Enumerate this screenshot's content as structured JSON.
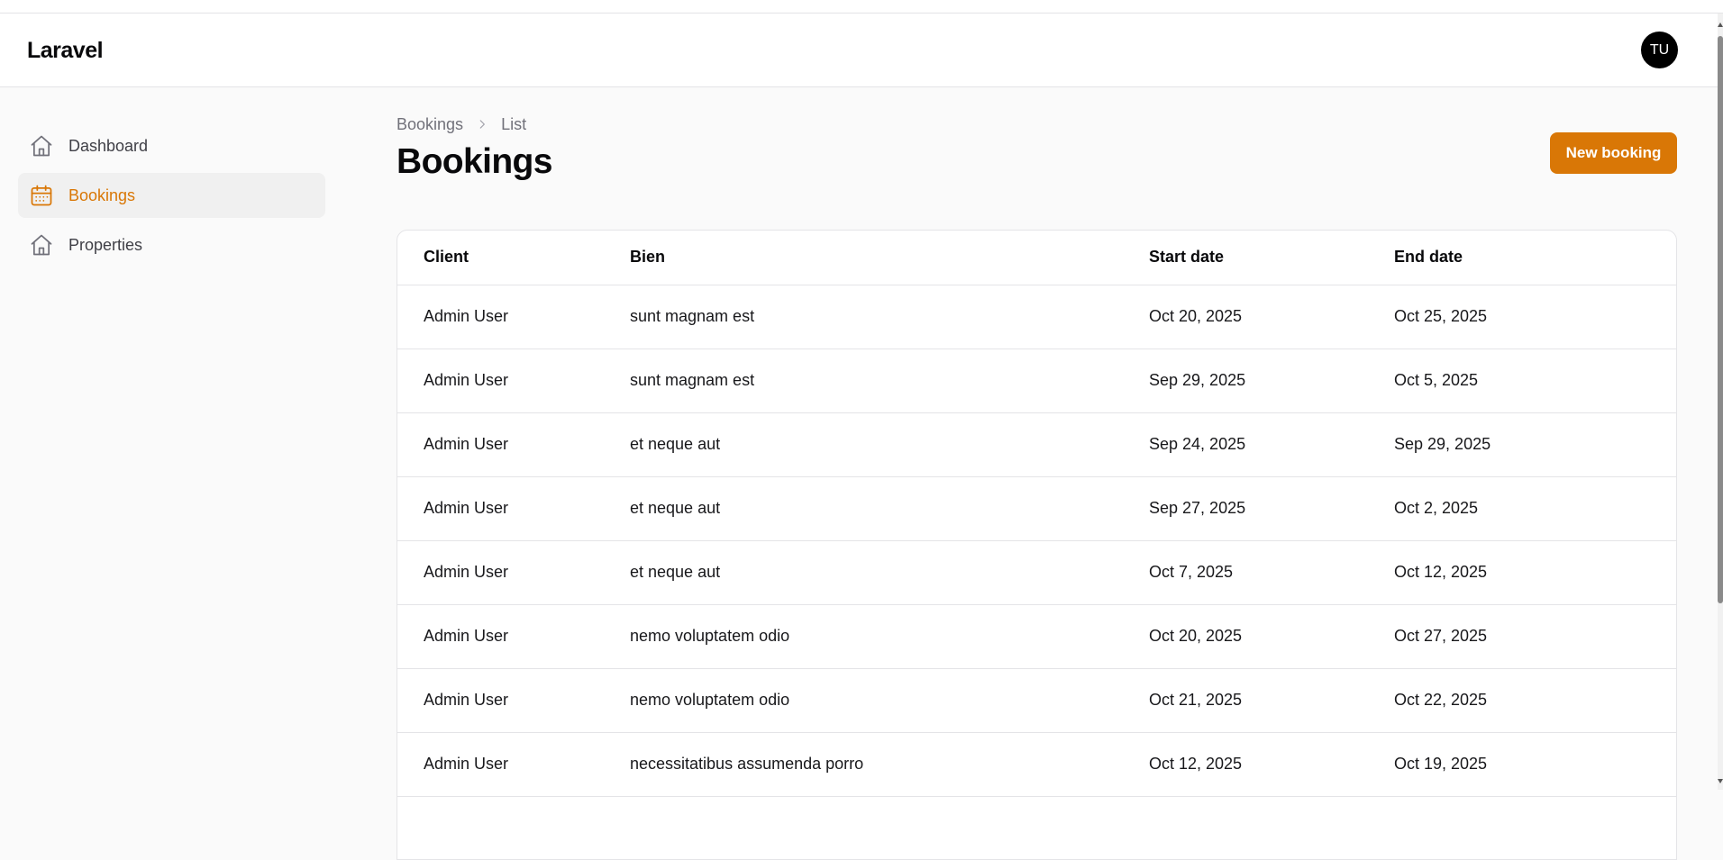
{
  "app": {
    "brand": "Laravel",
    "avatar_initials": "TU"
  },
  "sidebar": {
    "items": [
      {
        "label": "Dashboard",
        "icon": "home-icon",
        "active": false
      },
      {
        "label": "Bookings",
        "icon": "calendar-icon",
        "active": true
      },
      {
        "label": "Properties",
        "icon": "home-icon",
        "active": false
      }
    ]
  },
  "breadcrumb": {
    "items": [
      "Bookings",
      "List"
    ]
  },
  "page": {
    "title": "Bookings",
    "new_button_label": "New booking"
  },
  "table": {
    "headers": [
      "Client",
      "Bien",
      "Start date",
      "End date"
    ],
    "rows": [
      [
        "Admin User",
        "sunt magnam est",
        "Oct 20, 2025",
        "Oct 25, 2025"
      ],
      [
        "Admin User",
        "sunt magnam est",
        "Sep 29, 2025",
        "Oct 5, 2025"
      ],
      [
        "Admin User",
        "et neque aut",
        "Sep 24, 2025",
        "Sep 29, 2025"
      ],
      [
        "Admin User",
        "et neque aut",
        "Sep 27, 2025",
        "Oct 2, 2025"
      ],
      [
        "Admin User",
        "et neque aut",
        "Oct 7, 2025",
        "Oct 12, 2025"
      ],
      [
        "Admin User",
        "nemo voluptatem odio",
        "Oct 20, 2025",
        "Oct 27, 2025"
      ],
      [
        "Admin User",
        "nemo voluptatem odio",
        "Oct 21, 2025",
        "Oct 22, 2025"
      ],
      [
        "Admin User",
        "necessitatibus assumenda porro",
        "Oct 12, 2025",
        "Oct 19, 2025"
      ]
    ]
  },
  "colors": {
    "accent": "#d97706",
    "border": "#e4e4e7",
    "muted_text": "#71717a"
  }
}
